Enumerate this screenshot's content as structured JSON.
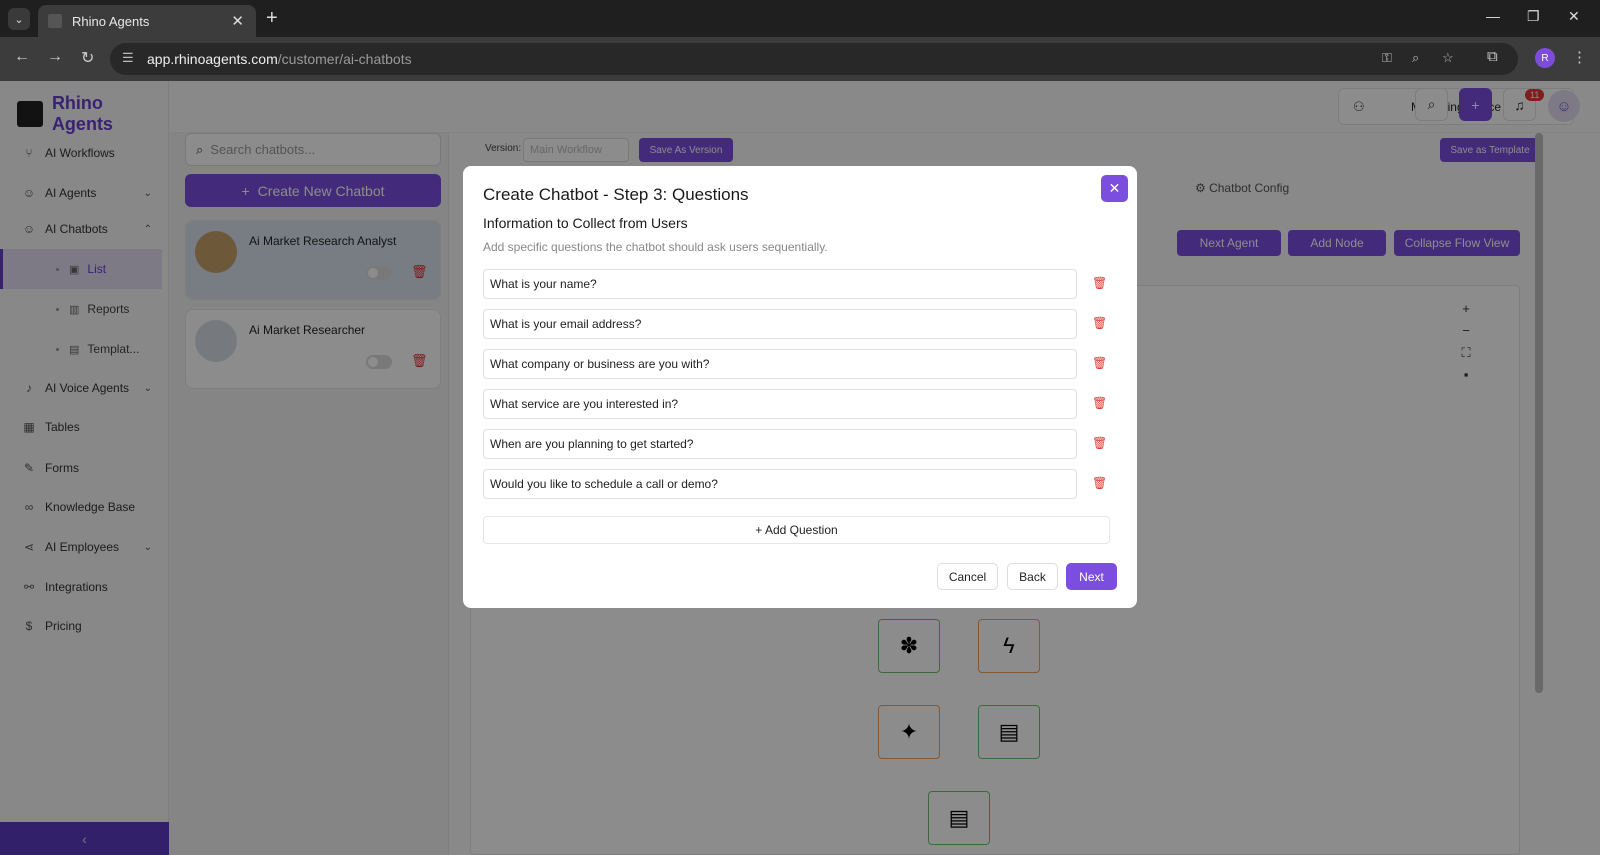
{
  "browser": {
    "tab_title": "Rhino Agents",
    "url_host": "app.rhinoagents.com",
    "url_path": "/customer/ai-chatbots",
    "profile_initial": "R"
  },
  "brand": {
    "name": "Rhino Agents"
  },
  "sidebar": {
    "items": [
      {
        "label": "AI Workflows",
        "icon": "workflow-icon"
      },
      {
        "label": "AI Agents",
        "icon": "agent-icon"
      },
      {
        "label": "AI Chatbots",
        "icon": "chatbot-icon"
      },
      {
        "label": "AI Voice Agents",
        "icon": "mic-icon"
      },
      {
        "label": "Tables",
        "icon": "table-icon"
      },
      {
        "label": "Forms",
        "icon": "form-icon"
      },
      {
        "label": "Knowledge Base",
        "icon": "link-icon"
      },
      {
        "label": "AI Employees",
        "icon": "share-icon"
      },
      {
        "label": "Integrations",
        "icon": "integration-icon"
      },
      {
        "label": "Pricing",
        "icon": "dollar-icon"
      }
    ],
    "subitems": [
      {
        "label": "List"
      },
      {
        "label": "Reports"
      },
      {
        "label": "Templat..."
      }
    ]
  },
  "topbar": {
    "space": "Marketing Space",
    "notifications": "11"
  },
  "list": {
    "search_placeholder": "Search chatbots...",
    "create_label": "Create New Chatbot",
    "chatbots": [
      {
        "name": "Ai Market Research Analyst"
      },
      {
        "name": "Ai Market Researcher"
      }
    ]
  },
  "canvas": {
    "version_label": "Version:",
    "version_value": "Main Workflow",
    "save_version": "Save As Version",
    "save_template": "Save as Template",
    "config_tab": "Chatbot Config",
    "next_agent": "Next Agent",
    "add_node": "Add Node",
    "collapse": "Collapse Flow View"
  },
  "modal": {
    "title": "Create Chatbot - Step 3: Questions",
    "subtitle": "Information to Collect from Users",
    "description": "Add specific questions the chatbot should ask users sequentially.",
    "questions": [
      "What is your name?",
      "What is your email address?",
      "What company or business are you with?",
      "What service are you interested in?",
      "When are you planning to get started?",
      "Would you like to schedule a call or demo?"
    ],
    "add_question": "+ Add Question",
    "cancel": "Cancel",
    "back": "Back",
    "next": "Next"
  },
  "colors": {
    "accent": "#7b4ee0",
    "brand": "#6a3fd1",
    "danger": "#d33333"
  }
}
